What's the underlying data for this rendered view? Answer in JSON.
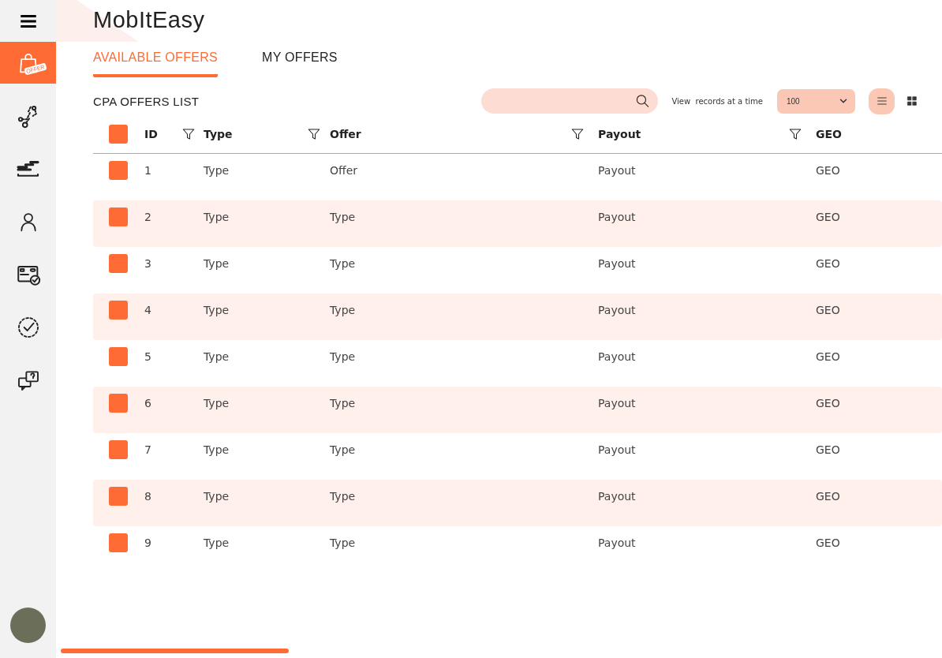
{
  "app": {
    "title": "MobItEasy"
  },
  "sidebar": {
    "items": [
      {
        "kind": "offers",
        "label": "OFFER",
        "selected": true
      },
      {
        "kind": "network",
        "selected": false
      },
      {
        "kind": "stats",
        "selected": false
      },
      {
        "kind": "user",
        "selected": false
      },
      {
        "kind": "payment",
        "selected": false
      },
      {
        "kind": "approve",
        "selected": false
      },
      {
        "kind": "support",
        "selected": false
      }
    ]
  },
  "tabs": [
    {
      "label": "AVAILABLE OFFERS",
      "selected": true
    },
    {
      "label": "MY OFFERS",
      "selected": false
    }
  ],
  "list_title": "CPA OFFERS LIST",
  "records": {
    "label": "View  records at a time",
    "value": "100"
  },
  "view_modes": [
    {
      "kind": "list",
      "selected": true
    },
    {
      "kind": "grid",
      "selected": false
    }
  ],
  "table": {
    "select_all_checked": true,
    "columns": [
      {
        "label": "ID",
        "filter": true
      },
      {
        "label": "Type",
        "filter": true
      },
      {
        "label": "Offer",
        "filter": true
      },
      {
        "label": "Payout",
        "filter": true
      },
      {
        "label": "GEO",
        "filter": false
      }
    ],
    "rows": [
      {
        "checked": true,
        "cells": [
          "1",
          "Type",
          "Offer",
          "Payout",
          "GEO"
        ]
      },
      {
        "checked": true,
        "cells": [
          "2",
          "Type",
          "Type",
          "Payout",
          "GEO"
        ]
      },
      {
        "checked": true,
        "cells": [
          "3",
          "Type",
          "Type",
          "Payout",
          "GEO"
        ]
      },
      {
        "checked": true,
        "cells": [
          "4",
          "Type",
          "Type",
          "Payout",
          "GEO"
        ]
      },
      {
        "checked": true,
        "cells": [
          "5",
          "Type",
          "Type",
          "Payout",
          "GEO"
        ]
      },
      {
        "checked": true,
        "cells": [
          "6",
          "Type",
          "Type",
          "Payout",
          "GEO"
        ]
      },
      {
        "checked": true,
        "cells": [
          "7",
          "Type",
          "Type",
          "Payout",
          "GEO"
        ]
      },
      {
        "checked": true,
        "cells": [
          "8",
          "Type",
          "Type",
          "Payout",
          "GEO"
        ]
      },
      {
        "checked": true,
        "cells": [
          "9",
          "Type",
          "Type",
          "Payout",
          "GEO"
        ]
      }
    ]
  }
}
